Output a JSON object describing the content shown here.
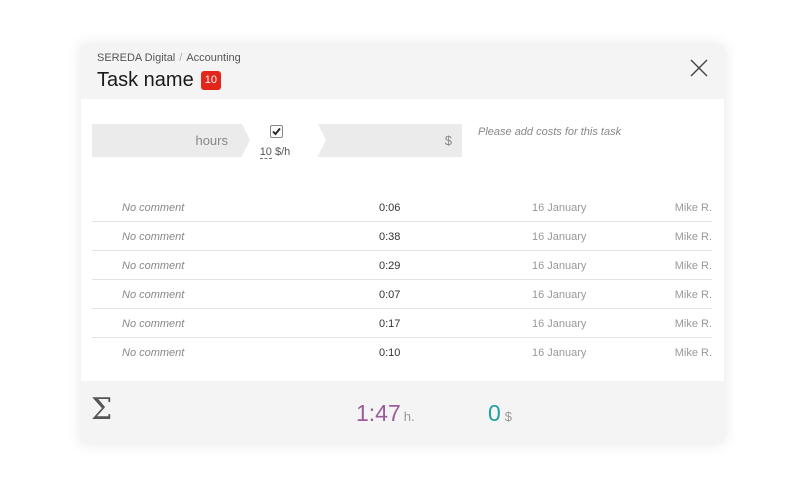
{
  "breadcrumb": {
    "project": "SEREDA Digital",
    "separator": "/",
    "section": "Accounting"
  },
  "task": {
    "title": "Task name",
    "badge_count": "10"
  },
  "icons": {
    "close": "close-icon",
    "check": "checkmark-icon",
    "sum": "sigma-icon"
  },
  "costs": {
    "hours_label": "hours",
    "billable_checked": true,
    "rate_value": "10",
    "rate_unit": "$/h",
    "currency_label": "$",
    "note": "Please add costs for this task"
  },
  "entries": [
    {
      "comment": "No comment",
      "duration": "0:06",
      "date": "16 January",
      "user": "Mike R."
    },
    {
      "comment": "No comment",
      "duration": "0:38",
      "date": "16 January",
      "user": "Mike R."
    },
    {
      "comment": "No comment",
      "duration": "0:29",
      "date": "16 January",
      "user": "Mike R."
    },
    {
      "comment": "No comment",
      "duration": "0:07",
      "date": "16 January",
      "user": "Mike R."
    },
    {
      "comment": "No comment",
      "duration": "0:17",
      "date": "16 January",
      "user": "Mike R."
    },
    {
      "comment": "No comment",
      "duration": "0:10",
      "date": "16 January",
      "user": "Mike R."
    }
  ],
  "totals": {
    "sigma": "Σ",
    "time": "1:47",
    "time_unit": "h.",
    "cost": "0",
    "cost_unit": "$"
  },
  "colors": {
    "badge": "#e2261c",
    "total_time": "#9c5c9c",
    "total_cost": "#20a0a0"
  }
}
